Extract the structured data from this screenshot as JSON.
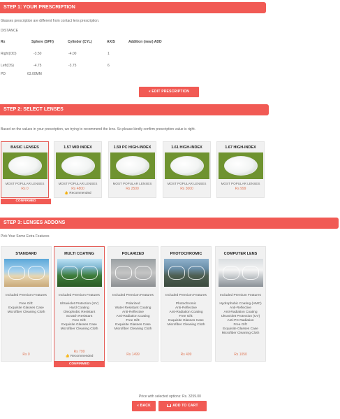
{
  "step1": {
    "title": "STEP 1: YOUR PRESCRIPTION",
    "note": "Glasses prescription are different from contact lens prescription.",
    "distance_label": "DISTANCE",
    "headers": {
      "rx": "Rx",
      "sphere": "Sphere (SPH)",
      "cylinder": "Cylinder (CYL)",
      "axis": "AXIS",
      "addition": "Addition (near) ADD"
    },
    "right": {
      "label": "Right(OD)",
      "sphere": "-3.50",
      "cylinder": "-4.00",
      "axis": "1"
    },
    "left": {
      "label": "Left(OS)",
      "sphere": "-4.75",
      "cylinder": "-3.75",
      "axis": "6"
    },
    "pd": {
      "label": "PD",
      "value": "63.00MM"
    },
    "edit_button": "« EDIT PRESCRIPTION"
  },
  "step2": {
    "title": "STEP 2: SELECT LENSES",
    "note": "Based on the values in your prescription, we trying to recommend the lens. So please kindly confirm prescription value is right.",
    "lenses": [
      {
        "title": "BASIC LENSES",
        "tag": "MOST POPULAR LENSES",
        "price": "Rs 0",
        "recommended": "",
        "selected": true
      },
      {
        "title": "1.57 MID INDEX",
        "tag": "MOST POPULAR LENSES",
        "price": "Rs 4800",
        "recommended": "Recommended",
        "selected": false
      },
      {
        "title": "1.59 PC HIGH-INDEX",
        "tag": "MOST POPULAR LENSES",
        "price": "Rs 2500",
        "recommended": "",
        "selected": false
      },
      {
        "title": "1.61 HIGH-INDEX",
        "tag": "MOST POPULAR LENSES",
        "price": "Rs 3000",
        "recommended": "",
        "selected": false
      },
      {
        "title": "1.67 HIGH-INDEX",
        "tag": "MOST POPULAR LENSES",
        "price": "Rs 999",
        "recommended": "",
        "selected": false
      }
    ],
    "confirmed_label": "CONFIRMED"
  },
  "step3": {
    "title": "STEP 3: LENSES ADDONS",
    "note": "Pick Your Some Extra Features",
    "addons": [
      {
        "title": "STANDARD",
        "features": [
          "Included Premium Features",
          "",
          "Free Gift:",
          "Exquisite Glasses Case",
          "Microfiber Cleaning Cloth"
        ],
        "price": "Rs 0",
        "recommended": "",
        "selected": false,
        "image": "glasses-beach-image"
      },
      {
        "title": "MULTI COATING",
        "features": [
          "Included Premium Features",
          "",
          "Ultraviolet Protection (UV)",
          "Hard Coating",
          "Oleophobic Resistant",
          "Scratch Resistant",
          "Free Gift:",
          "Exquisite Glasses Case",
          "Microfiber Cleaning Cloth"
        ],
        "price": "Rs 799",
        "recommended": "Recommended",
        "selected": true,
        "image": "glasses-trees-image"
      },
      {
        "title": "POLARIZED",
        "features": [
          "Included Premium Features",
          "",
          "Polarized",
          "Water Resistant Coating",
          "Anti-Reflective",
          "Anti-Radiation Coating",
          "Free Gift:",
          "Exquisite Glasses Case",
          "Microfiber Cleaning Cloth"
        ],
        "price": "Rs 1499",
        "recommended": "",
        "selected": false,
        "image": "glasses-tinted-image"
      },
      {
        "title": "PHOTOCHROMIC",
        "features": [
          "Included Premium Features",
          "",
          "Photochromic",
          "Anti-Reflective",
          "Anti-Radiation Coating",
          "Free Gift:",
          "Exquisite Glasses Case",
          "Microfiber Cleaning Cloth"
        ],
        "price": "Rs 499",
        "recommended": "",
        "selected": false,
        "image": "glasses-mountain-image"
      },
      {
        "title": "COMPUTER LENS",
        "features": [
          "Included Premium Features",
          "",
          "Hydrophobic Coating (HMC)",
          "Anti-Reflective",
          "Anti-Radiation Coating",
          "Ultraviolet Protection (UV)",
          "Anti-PC Radiation",
          "Free Gift:",
          "Exquisite Glasses Case",
          "Microfiber Cleaning Cloth"
        ],
        "price": "Rs 1050",
        "recommended": "",
        "selected": false,
        "image": "glasses-laptop-image"
      }
    ],
    "confirmed_label": "CONFIRMED"
  },
  "footer": {
    "price_text": "Price with selected options: Rs. 3259.00",
    "back_button": "« BACK",
    "cart_button": "ADD TO CART",
    "cart_icon": "cart-icon"
  },
  "colors": {
    "accent": "#f15a54",
    "price": "#e07c5c",
    "lens_bg": "#6f9330"
  }
}
